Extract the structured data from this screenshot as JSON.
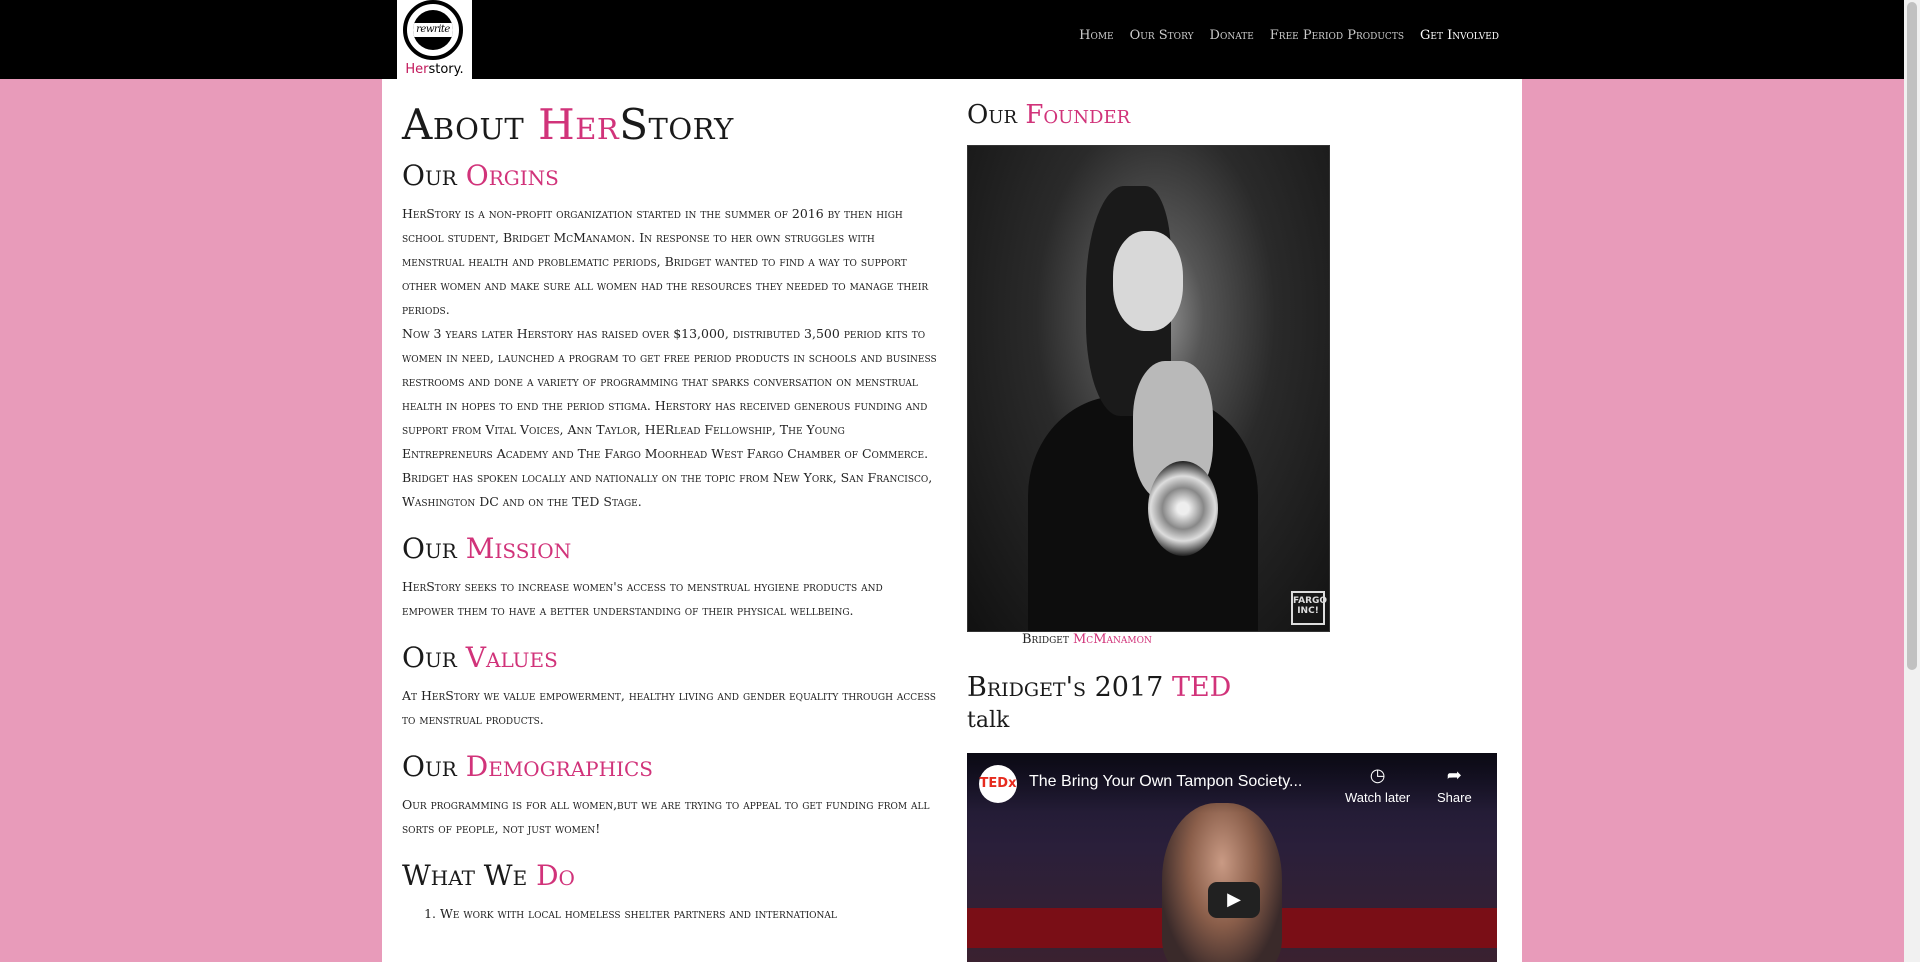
{
  "logo": {
    "circle_text": "rewrite",
    "name_a": "Her",
    "name_b": "story."
  },
  "nav": {
    "items": [
      "Home",
      "Our Story",
      "Donate",
      "Free Period Products",
      "Get Involved"
    ]
  },
  "main": {
    "title_a": "About ",
    "title_b": "Her",
    "title_c": "Story",
    "origins": {
      "heading_a": "Our ",
      "heading_b": "Orgins",
      "p1": "HerStory is a non-profit organization started in the summer of 2016 by then high school student, Bridget McManamon. In response to her own struggles with menstrual health and problematic periods, Bridget wanted to find a way to support other women and make sure all women had the resources they needed to manage their periods.",
      "p2": "Now 3 years later Herstory has raised over $13,000, distributed 3,500 period kits to women in need, launched a program to get free period products in schools and business restrooms and done a variety of programming that sparks conversation on menstrual health in hopes to end the period stigma. Herstory has received generous funding and support from Vital Voices, Ann Taylor, HERlead Fellowship, The Young Entrepreneurs Academy and The Fargo Moorhead West Fargo Chamber of Commerce. Bridget has spoken locally and nationally on the topic from New York, San Francisco, Washington DC and on the TED Stage."
    },
    "mission": {
      "heading_a": "Our ",
      "heading_b": "Mission",
      "text": "HerStory seeks to increase women's access to menstrual hygiene products and empower them to have a better understanding of their physical wellbeing."
    },
    "values": {
      "heading_a": "Our ",
      "heading_b": "Values",
      "text": "At HerStory we value empowerment, healthy living and gender equality through access to menstrual products."
    },
    "demographics": {
      "heading_a": "Our ",
      "heading_b": "Demographics",
      "text": "Our programming is for all women,but we are trying to appeal to get funding from all sorts of people, not just women!"
    },
    "whatwedo": {
      "heading_a": "What We ",
      "heading_b": "Do",
      "items": [
        "We work with local homeless shelter partners and international"
      ]
    }
  },
  "founder": {
    "heading_a": "Our ",
    "heading_b": "Founder",
    "photo_badge": "FARGO INC!",
    "caption_a": "Bridget ",
    "caption_b": "McManamon"
  },
  "ted": {
    "heading_a": "Bridget's 2017 ",
    "heading_b": "TED",
    "heading_c": "talk",
    "video": {
      "channel": "TEDx",
      "title": "The Bring Your Own Tampon Society...",
      "watch_later": "Watch later",
      "share": "Share"
    }
  }
}
